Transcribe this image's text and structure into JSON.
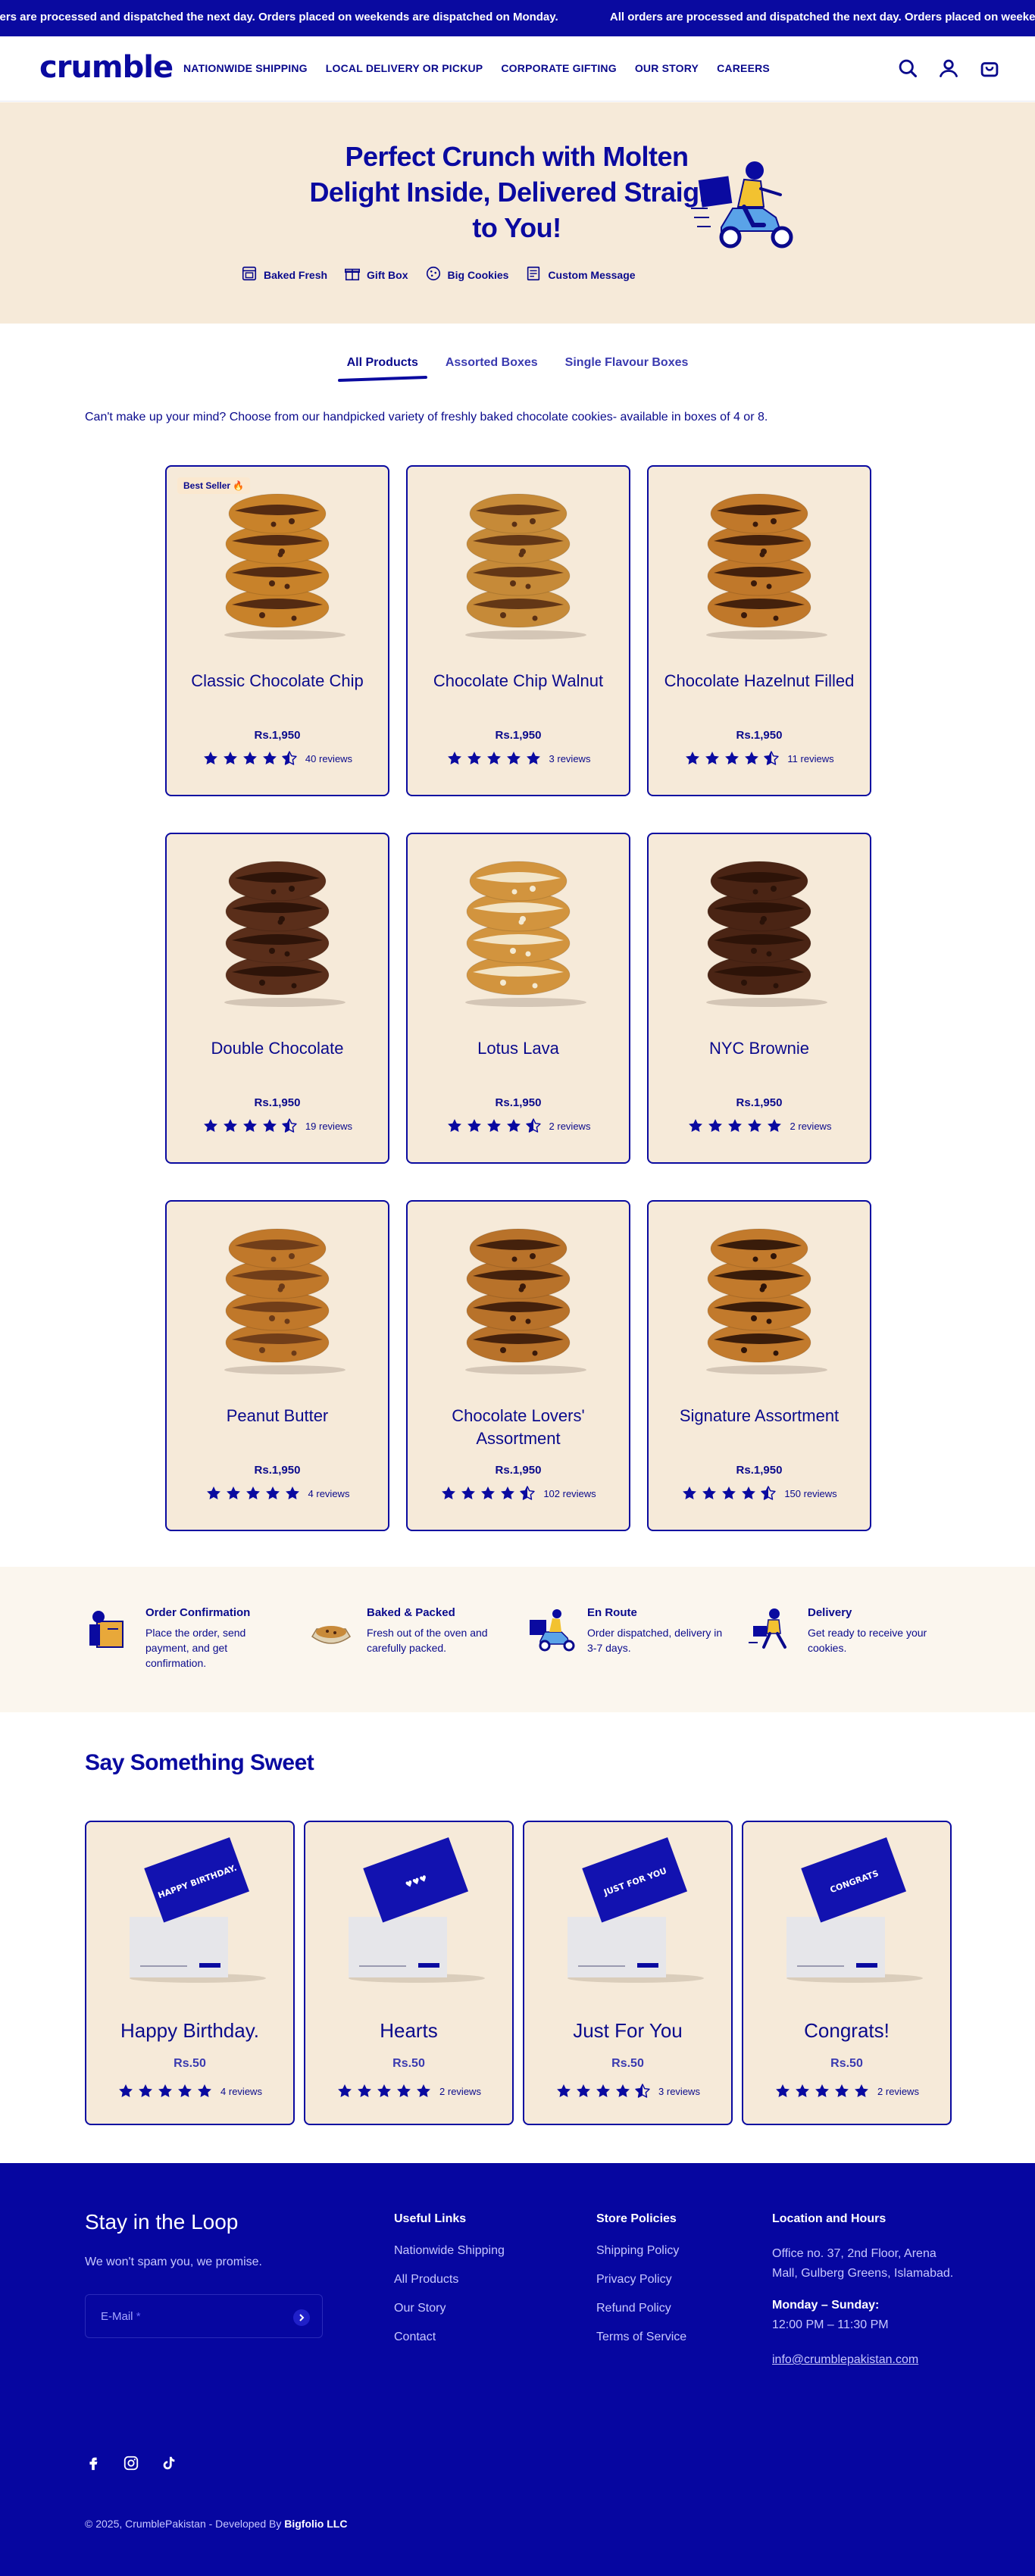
{
  "announcement": {
    "messages": [
      "All orders are processed and dispatched the next day. Orders placed on weekends are dispatched on Monday.",
      "All orders are processed and dispatched the next day. Orders placed on weekends are dispatched on Monday."
    ]
  },
  "header": {
    "logo": "crumble",
    "nav": [
      "NATIONWIDE SHIPPING",
      "LOCAL DELIVERY OR PICKUP",
      "CORPORATE GIFTING",
      "OUR STORY",
      "CAREERS"
    ],
    "icons": [
      "search-icon",
      "account-icon",
      "cart-icon"
    ]
  },
  "hero": {
    "title": "Perfect Crunch with Molten Delight Inside, Delivered Straight to You!",
    "features": [
      "Baked Fresh",
      "Gift Box",
      "Big Cookies",
      "Custom Message"
    ]
  },
  "tabs": [
    "All Products",
    "Assorted Boxes",
    "Single Flavour Boxes"
  ],
  "intro": "Can't make up your mind? Choose from our handpicked variety of freshly baked chocolate cookies- available in boxes of 4 or 8.",
  "products": [
    {
      "name": "Classic Chocolate Chip",
      "price": "Rs.1,950",
      "rating": 4.5,
      "reviews": "40 reviews",
      "badge": "Best Seller 🔥",
      "cookie": "#c8822a",
      "filling": "#4a2410"
    },
    {
      "name": "Chocolate Chip Walnut",
      "price": "Rs.1,950",
      "rating": 5,
      "reviews": "3 reviews",
      "badge": "",
      "cookie": "#c68a38",
      "filling": "#5a3014"
    },
    {
      "name": "Chocolate Hazelnut Filled",
      "price": "Rs.1,950",
      "rating": 4.5,
      "reviews": "11 reviews",
      "badge": "",
      "cookie": "#c0782a",
      "filling": "#3a1a0a"
    },
    {
      "name": "Double Chocolate",
      "price": "Rs.1,950",
      "rating": 4.5,
      "reviews": "19 reviews",
      "badge": "",
      "cookie": "#5a2e1a",
      "filling": "#2a1208"
    },
    {
      "name": "Lotus Lava",
      "price": "Rs.1,950",
      "rating": 4.5,
      "reviews": "2 reviews",
      "badge": "",
      "cookie": "#d2943e",
      "filling": "#f4ead2"
    },
    {
      "name": "NYC Brownie",
      "price": "Rs.1,950",
      "rating": 5,
      "reviews": "2 reviews",
      "badge": "",
      "cookie": "#4a2414",
      "filling": "#2a1208"
    },
    {
      "name": "Peanut Butter",
      "price": "Rs.1,950",
      "rating": 5,
      "reviews": "4 reviews",
      "badge": "",
      "cookie": "#c0782a",
      "filling": "#6a3a18"
    },
    {
      "name": "Chocolate Lovers' Assortment",
      "price": "Rs.1,950",
      "rating": 4.5,
      "reviews": "102 reviews",
      "badge": "",
      "cookie": "#b8722a",
      "filling": "#3a1a0a"
    },
    {
      "name": "Signature Assortment",
      "price": "Rs.1,950",
      "rating": 4.5,
      "reviews": "150 reviews",
      "badge": "",
      "cookie": "#c27a2c",
      "filling": "#2e1408"
    }
  ],
  "steps": [
    {
      "title": "Order Confirmation",
      "text": "Place the order, send payment, and get confirmation."
    },
    {
      "title": "Baked & Packed",
      "text": "Fresh out of the oven and carefully packed."
    },
    {
      "title": "En Route",
      "text": "Order dispatched, delivery in 3-7 days."
    },
    {
      "title": "Delivery",
      "text": "Get ready to receive your cookies."
    }
  ],
  "messages_section": {
    "title": "Say Something Sweet",
    "cards": [
      {
        "name": "Happy Birthday.",
        "price": "Rs.50",
        "rating": 5,
        "reviews": "4 reviews",
        "card_text": "HAPPY BIRTHDAY."
      },
      {
        "name": "Hearts",
        "price": "Rs.50",
        "rating": 5,
        "reviews": "2 reviews",
        "card_text": "♥♥♥"
      },
      {
        "name": "Just For You",
        "price": "Rs.50",
        "rating": 4.5,
        "reviews": "3 reviews",
        "card_text": "JUST FOR YOU"
      },
      {
        "name": "Congrats!",
        "price": "Rs.50",
        "rating": 5,
        "reviews": "2 reviews",
        "card_text": "CONGRATS"
      }
    ]
  },
  "footer": {
    "loop_title": "Stay in the Loop",
    "spam_note": "We won't spam you, we promise.",
    "email_placeholder": "E-Mail",
    "email_required": "*",
    "useful_links": {
      "title": "Useful Links",
      "items": [
        "Nationwide Shipping",
        "All Products",
        "Our Story",
        "Contact"
      ]
    },
    "policies": {
      "title": "Store Policies",
      "items": [
        "Shipping Policy",
        "Privacy Policy",
        "Refund Policy",
        "Terms of Service"
      ]
    },
    "location": {
      "title": "Location and Hours",
      "address": "Office no. 37, 2nd Floor, Arena Mall, Gulberg Greens, Islamabad.",
      "days": "Monday – Sunday:",
      "hours": "12:00 PM – 11:30 PM",
      "email": "info@crumblepakistan.com"
    },
    "social": [
      "facebook-icon",
      "instagram-icon",
      "tiktok-icon"
    ],
    "copyright": "© 2025, CrumblePakistan - Developed By",
    "developer": "Bigfolio LLC"
  }
}
